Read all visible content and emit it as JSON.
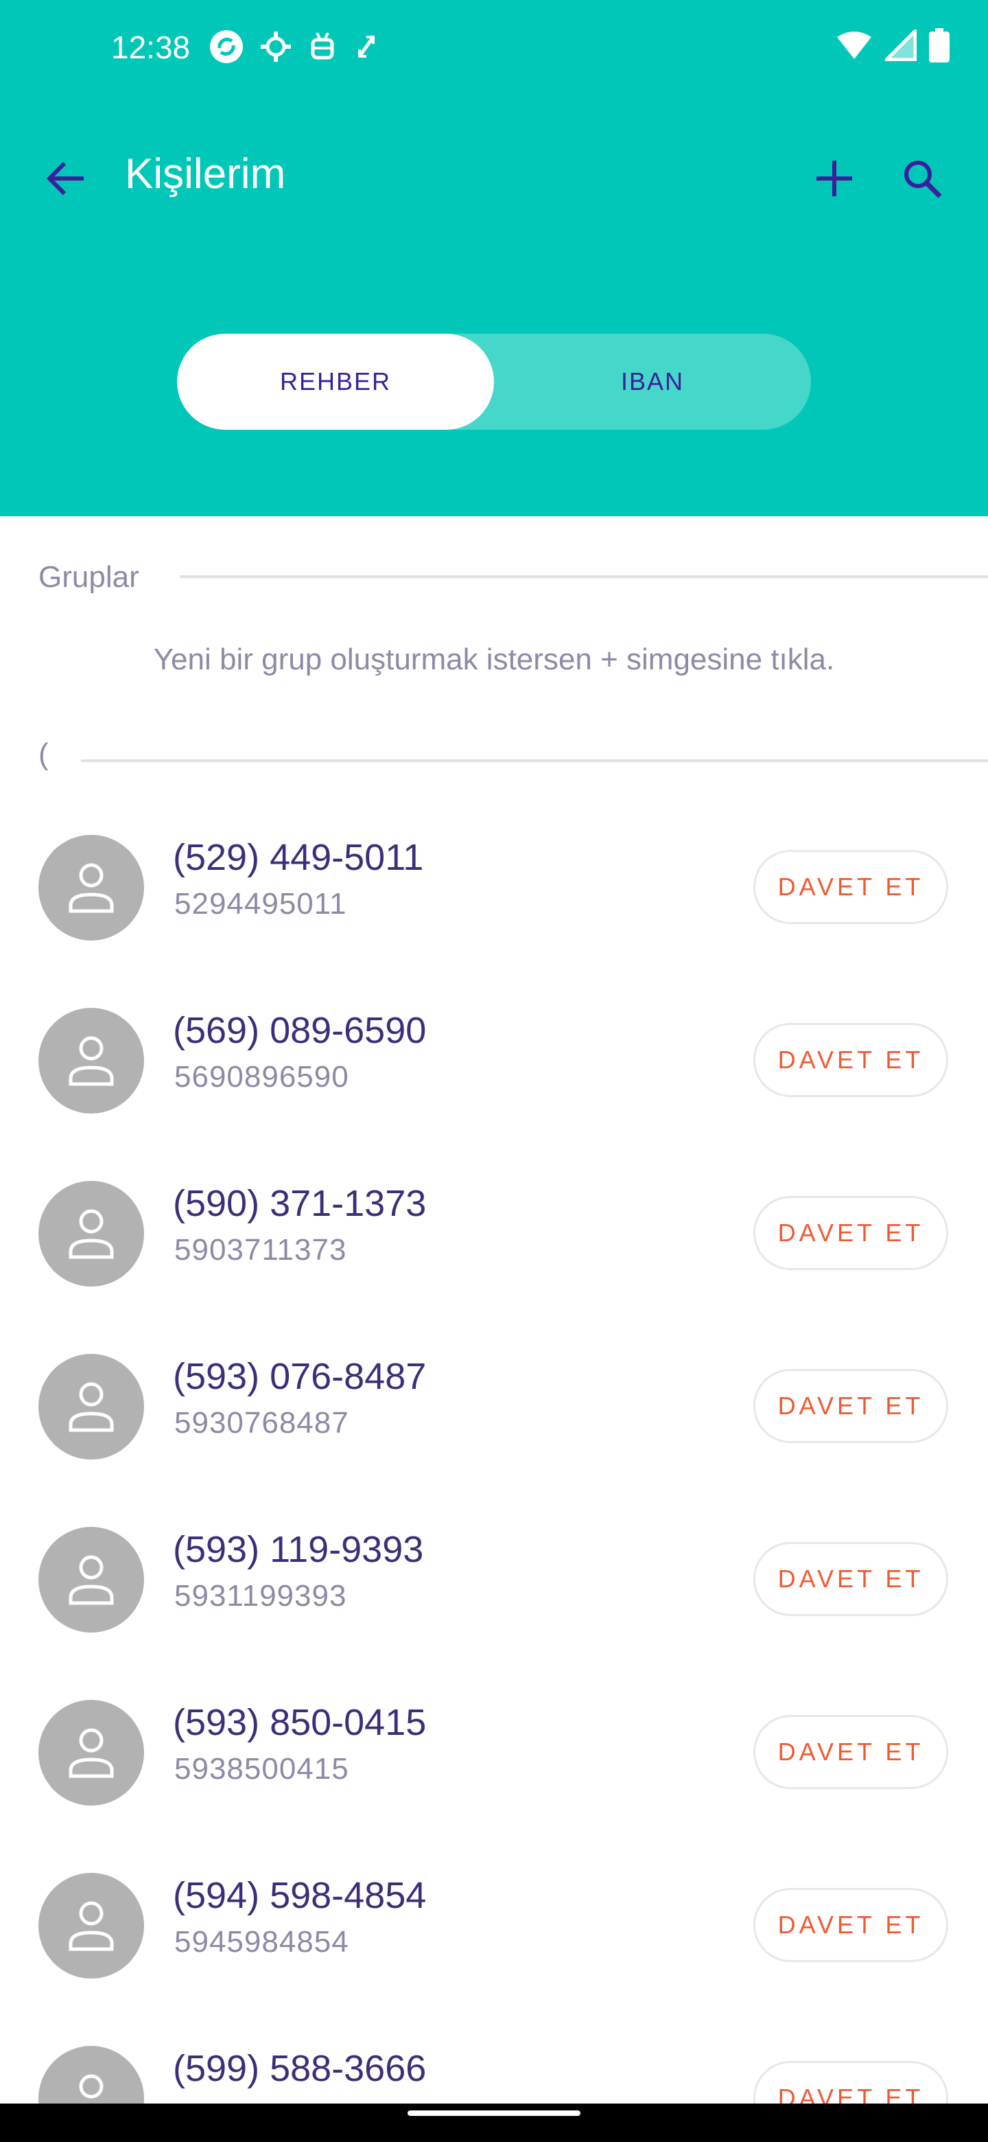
{
  "status_bar": {
    "time": "12:38",
    "left_icons": [
      "notification-sync-icon",
      "gear-icon",
      "android-icon",
      "expand-icon"
    ],
    "right_icons": [
      "wifi-icon",
      "signal-icon",
      "battery-icon"
    ]
  },
  "app_bar": {
    "title": "Kişilerim",
    "back_icon": "arrow-back-icon",
    "add_icon": "plus-icon",
    "search_icon": "search-icon"
  },
  "tabs": [
    {
      "label": "REHBER",
      "selected": true
    },
    {
      "label": "IBAN",
      "selected": false
    }
  ],
  "groups": {
    "label": "Gruplar",
    "hint": "Yeni bir grup oluşturmak istersen + simgesine tıkla."
  },
  "contacts_section_label": "(",
  "contacts": [
    {
      "title": "(529) 449-5011",
      "subtitle": "5294495011",
      "action": "DAVET ET"
    },
    {
      "title": "(569) 089-6590",
      "subtitle": "5690896590",
      "action": "DAVET ET"
    },
    {
      "title": "(590) 371-1373",
      "subtitle": "5903711373",
      "action": "DAVET ET"
    },
    {
      "title": "(593) 076-8487",
      "subtitle": "5930768487",
      "action": "DAVET ET"
    },
    {
      "title": "(593) 119-9393",
      "subtitle": "5931199393",
      "action": "DAVET ET"
    },
    {
      "title": "(593) 850-0415",
      "subtitle": "5938500415",
      "action": "DAVET ET"
    },
    {
      "title": "(594) 598-4854",
      "subtitle": "5945984854",
      "action": "DAVET ET"
    },
    {
      "title": "(599) 588-3666",
      "subtitle": "",
      "action": "DAVET ET"
    }
  ],
  "colors": {
    "header": "#00C7B8",
    "tab_inactive": "#45D7C9",
    "tab_text": "#3B1F9C",
    "icon_purple": "#3B1F9C",
    "contact_title": "#3E2D78",
    "muted_text": "#8E8AA6",
    "invite": "#F05A33",
    "avatar": "#B2B2B2"
  }
}
